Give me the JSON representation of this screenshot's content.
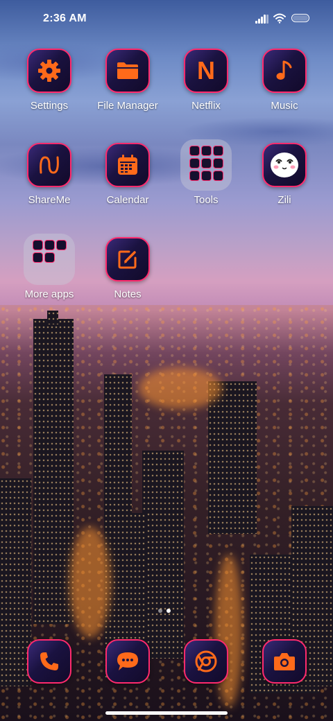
{
  "status_bar": {
    "time": "2:36 AM"
  },
  "apps": [
    {
      "label": "Settings",
      "icon": "gear-icon"
    },
    {
      "label": "File Manager",
      "icon": "folder-icon"
    },
    {
      "label": "Netflix",
      "icon": "netflix-icon",
      "glyph": "N"
    },
    {
      "label": "Music",
      "icon": "music-note-icon"
    },
    {
      "label": "ShareMe",
      "icon": "shareme-icon"
    },
    {
      "label": "Calendar",
      "icon": "calendar-icon"
    },
    {
      "label": "Tools",
      "icon": "folder-tools-icon"
    },
    {
      "label": "Zili",
      "icon": "zili-face-icon"
    },
    {
      "label": "More apps",
      "icon": "folder-more-apps-icon"
    },
    {
      "label": "Notes",
      "icon": "notes-icon"
    }
  ],
  "dock": [
    {
      "icon": "phone-icon"
    },
    {
      "icon": "messages-icon"
    },
    {
      "icon": "chrome-icon"
    },
    {
      "icon": "camera-icon"
    }
  ],
  "colors": {
    "accent": "#ff6a1a",
    "border": "#ff2a6d",
    "tile_dark": "#15102e"
  }
}
